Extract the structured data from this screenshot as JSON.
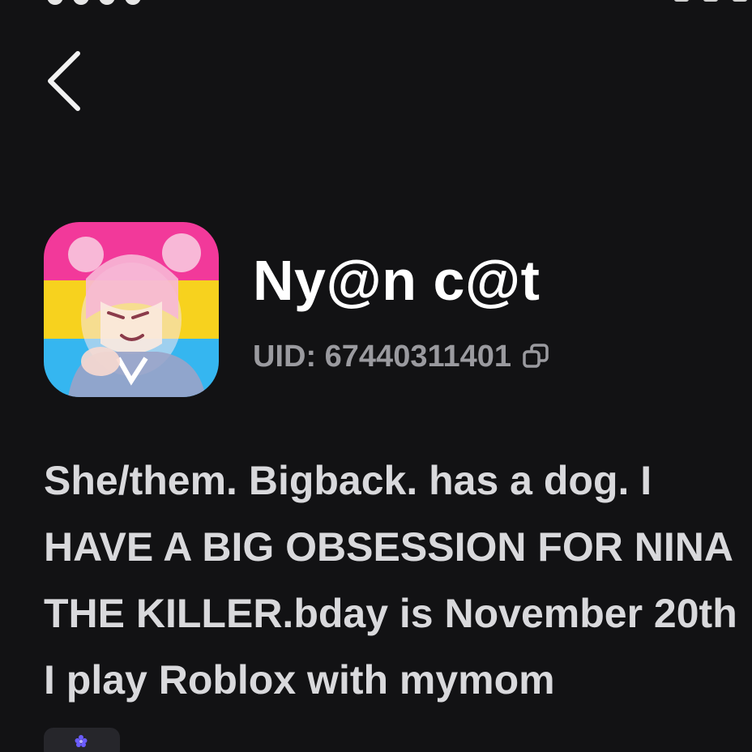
{
  "profile": {
    "name": "Ny@n c@t",
    "uid": "UID: 67440311401",
    "bio_lines": [
      "She/them. Bigback. has a dog. I",
      "HAVE A BIG OBSESSION FOR NINA",
      "THE KILLER.bday is November 20th",
      "I play Roblox with mymom"
    ]
  },
  "icons": {
    "back": "chevron-left-icon",
    "copy": "copy-icon",
    "chip": "flower-icon"
  },
  "colors": {
    "background": "#121214",
    "name_text": "#ffffff",
    "uid_text": "#9a9a9f",
    "bio_text": "#d9d9dc",
    "avatar_band_top": "#f2399a",
    "avatar_band_mid": "#f7d21e",
    "avatar_band_bottom": "#35b6f0",
    "chip_accent": "#6b5cff"
  }
}
